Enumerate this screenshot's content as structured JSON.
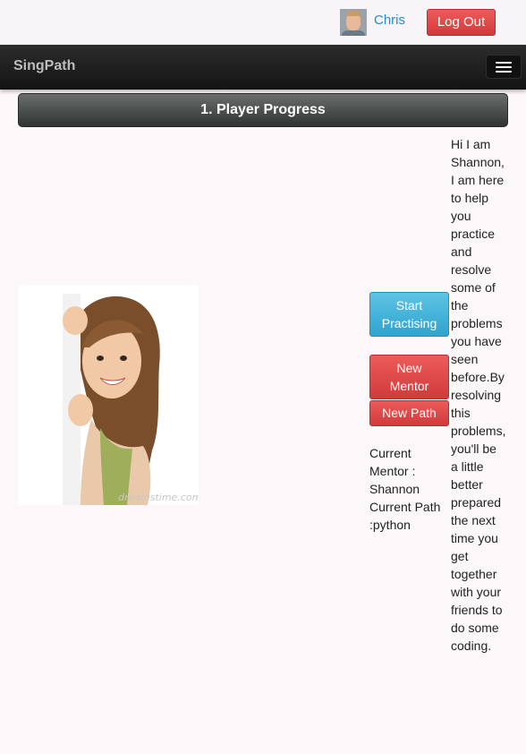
{
  "topbar": {
    "username": "Chris",
    "logout_label": "Log Out"
  },
  "navbar": {
    "brand": "SingPath"
  },
  "section": {
    "title": "1. Player Progress"
  },
  "actions": {
    "start_label_line1": "Start",
    "start_label_line2": "Practising",
    "new_mentor_line1": "New",
    "new_mentor_line2": "Mentor",
    "new_path_label": "New Path"
  },
  "mentor_info": {
    "line1": "Current",
    "line2": "Mentor :",
    "line3": "Shannon",
    "line4": "Current Path",
    "line5": ":python"
  },
  "speech": [
    "Hi I am",
    "Shannon,",
    "I am here",
    "to help",
    "you",
    "practice",
    "and",
    "resolve",
    "some of",
    "the",
    "problems",
    "you have",
    "seen",
    "before.By",
    "resolving",
    "this",
    "problems,",
    "you'll be",
    "a little",
    "better",
    "prepared",
    "the next",
    "time you",
    "get",
    "together",
    "with your",
    "friends to",
    "do some",
    "coding."
  ],
  "photo_watermark": "dreamstime.com",
  "colors": {
    "primary_red": "#d13a3a",
    "info_blue": "#2fa4cf",
    "link_blue": "#1f8fd1",
    "navbar_dark": "#141414"
  }
}
